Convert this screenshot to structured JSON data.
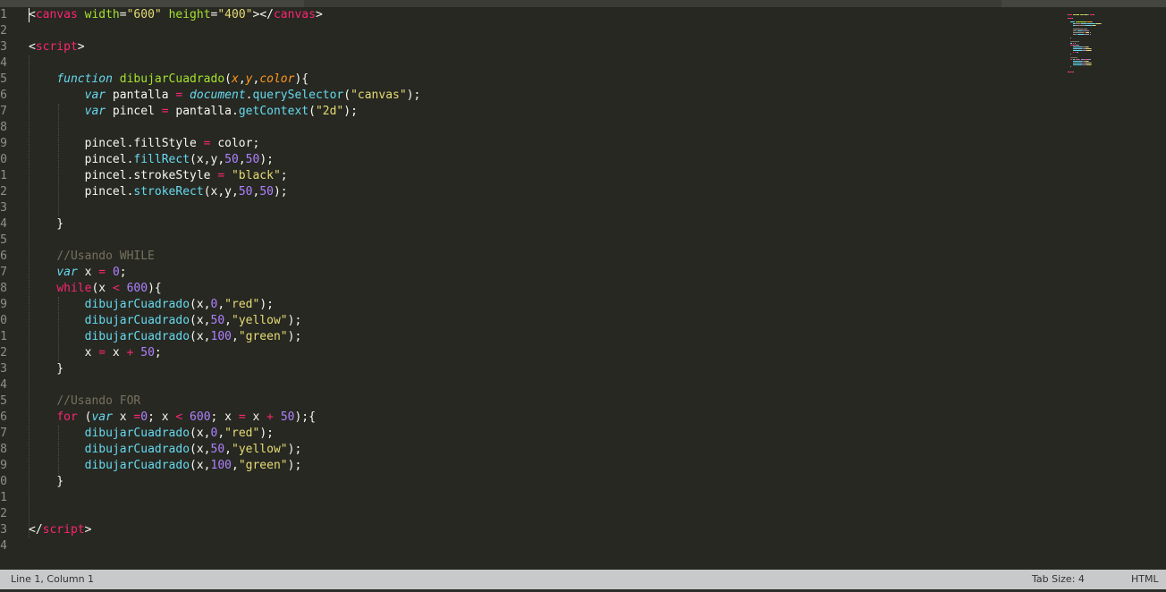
{
  "editor": {
    "line_numbers": [
      "1",
      "2",
      "3",
      "4",
      "5",
      "6",
      "7",
      "8",
      "9",
      "0",
      "1",
      "2",
      "3",
      "4",
      "5",
      "6",
      "7",
      "8",
      "9",
      "0",
      "1",
      "2",
      "3",
      "4",
      "5",
      "6",
      "7",
      "8",
      "9",
      "0",
      "1",
      "2",
      "3",
      "4"
    ],
    "lines": [
      [
        [
          "t-plain",
          "<"
        ],
        [
          "t-tag",
          "canvas"
        ],
        [
          "t-plain",
          " "
        ],
        [
          "t-attr",
          "width"
        ],
        [
          "t-plain",
          "="
        ],
        [
          "t-str",
          "\"600\""
        ],
        [
          "t-plain",
          " "
        ],
        [
          "t-attr",
          "height"
        ],
        [
          "t-plain",
          "="
        ],
        [
          "t-str",
          "\"400\""
        ],
        [
          "t-plain",
          "></"
        ],
        [
          "t-tag",
          "canvas"
        ],
        [
          "t-plain",
          ">"
        ]
      ],
      [],
      [
        [
          "t-plain",
          "<"
        ],
        [
          "t-tag",
          "script"
        ],
        [
          "t-plain",
          ">"
        ]
      ],
      [],
      [
        [
          "t-plain",
          "    "
        ],
        [
          "t-kw",
          "function"
        ],
        [
          "t-plain",
          " "
        ],
        [
          "t-fn",
          "dibujarCuadrado"
        ],
        [
          "t-plain",
          "("
        ],
        [
          "t-param",
          "x"
        ],
        [
          "t-plain",
          ","
        ],
        [
          "t-param",
          "y"
        ],
        [
          "t-plain",
          ","
        ],
        [
          "t-param",
          "color"
        ],
        [
          "t-plain",
          "){"
        ]
      ],
      [
        [
          "t-plain",
          "        "
        ],
        [
          "t-kw",
          "var"
        ],
        [
          "t-plain",
          " pantalla "
        ],
        [
          "t-op",
          "="
        ],
        [
          "t-plain",
          " "
        ],
        [
          "t-kw",
          "document"
        ],
        [
          "t-plain",
          "."
        ],
        [
          "t-prop",
          "querySelector"
        ],
        [
          "t-plain",
          "("
        ],
        [
          "t-str",
          "\"canvas\""
        ],
        [
          "t-plain",
          ");"
        ]
      ],
      [
        [
          "t-plain",
          "        "
        ],
        [
          "t-kw",
          "var"
        ],
        [
          "t-plain",
          " pincel "
        ],
        [
          "t-op",
          "="
        ],
        [
          "t-plain",
          " pantalla."
        ],
        [
          "t-prop",
          "getContext"
        ],
        [
          "t-plain",
          "("
        ],
        [
          "t-str",
          "\"2d\""
        ],
        [
          "t-plain",
          ");"
        ]
      ],
      [],
      [
        [
          "t-plain",
          "        pincel.fillStyle "
        ],
        [
          "t-op",
          "="
        ],
        [
          "t-plain",
          " color;"
        ]
      ],
      [
        [
          "t-plain",
          "        pincel."
        ],
        [
          "t-prop",
          "fillRect"
        ],
        [
          "t-plain",
          "(x,y,"
        ],
        [
          "t-num",
          "50"
        ],
        [
          "t-plain",
          ","
        ],
        [
          "t-num",
          "50"
        ],
        [
          "t-plain",
          ");"
        ]
      ],
      [
        [
          "t-plain",
          "        pincel.strokeStyle "
        ],
        [
          "t-op",
          "="
        ],
        [
          "t-plain",
          " "
        ],
        [
          "t-str",
          "\"black\""
        ],
        [
          "t-plain",
          ";"
        ]
      ],
      [
        [
          "t-plain",
          "        pincel."
        ],
        [
          "t-prop",
          "strokeRect"
        ],
        [
          "t-plain",
          "(x,y,"
        ],
        [
          "t-num",
          "50"
        ],
        [
          "t-plain",
          ","
        ],
        [
          "t-num",
          "50"
        ],
        [
          "t-plain",
          ");"
        ]
      ],
      [],
      [
        [
          "t-plain",
          "    }"
        ]
      ],
      [],
      [
        [
          "t-plain",
          "    "
        ],
        [
          "t-com",
          "//Usando WHILE"
        ]
      ],
      [
        [
          "t-plain",
          "    "
        ],
        [
          "t-kw",
          "var"
        ],
        [
          "t-plain",
          " x "
        ],
        [
          "t-op",
          "="
        ],
        [
          "t-plain",
          " "
        ],
        [
          "t-num",
          "0"
        ],
        [
          "t-plain",
          ";"
        ]
      ],
      [
        [
          "t-plain",
          "    "
        ],
        [
          "t-kwp",
          "while"
        ],
        [
          "t-plain",
          "(x "
        ],
        [
          "t-op",
          "<"
        ],
        [
          "t-plain",
          " "
        ],
        [
          "t-num",
          "600"
        ],
        [
          "t-plain",
          "){"
        ]
      ],
      [
        [
          "t-plain",
          "        "
        ],
        [
          "t-prop",
          "dibujarCuadrado"
        ],
        [
          "t-plain",
          "(x,"
        ],
        [
          "t-num",
          "0"
        ],
        [
          "t-plain",
          ","
        ],
        [
          "t-str",
          "\"red\""
        ],
        [
          "t-plain",
          ");"
        ]
      ],
      [
        [
          "t-plain",
          "        "
        ],
        [
          "t-prop",
          "dibujarCuadrado"
        ],
        [
          "t-plain",
          "(x,"
        ],
        [
          "t-num",
          "50"
        ],
        [
          "t-plain",
          ","
        ],
        [
          "t-str",
          "\"yellow\""
        ],
        [
          "t-plain",
          ");"
        ]
      ],
      [
        [
          "t-plain",
          "        "
        ],
        [
          "t-prop",
          "dibujarCuadrado"
        ],
        [
          "t-plain",
          "(x,"
        ],
        [
          "t-num",
          "100"
        ],
        [
          "t-plain",
          ","
        ],
        [
          "t-str",
          "\"green\""
        ],
        [
          "t-plain",
          ");"
        ]
      ],
      [
        [
          "t-plain",
          "        x "
        ],
        [
          "t-op",
          "="
        ],
        [
          "t-plain",
          " x "
        ],
        [
          "t-op",
          "+"
        ],
        [
          "t-plain",
          " "
        ],
        [
          "t-num",
          "50"
        ],
        [
          "t-plain",
          ";"
        ]
      ],
      [
        [
          "t-plain",
          "    }"
        ]
      ],
      [],
      [
        [
          "t-plain",
          "    "
        ],
        [
          "t-com",
          "//Usando FOR"
        ]
      ],
      [
        [
          "t-plain",
          "    "
        ],
        [
          "t-kwp",
          "for"
        ],
        [
          "t-plain",
          " ("
        ],
        [
          "t-kw",
          "var"
        ],
        [
          "t-plain",
          " x "
        ],
        [
          "t-op",
          "="
        ],
        [
          "t-num",
          "0"
        ],
        [
          "t-plain",
          "; x "
        ],
        [
          "t-op",
          "<"
        ],
        [
          "t-plain",
          " "
        ],
        [
          "t-num",
          "600"
        ],
        [
          "t-plain",
          "; x "
        ],
        [
          "t-op",
          "="
        ],
        [
          "t-plain",
          " x "
        ],
        [
          "t-op",
          "+"
        ],
        [
          "t-plain",
          " "
        ],
        [
          "t-num",
          "50"
        ],
        [
          "t-plain",
          ");{"
        ]
      ],
      [
        [
          "t-plain",
          "        "
        ],
        [
          "t-prop",
          "dibujarCuadrado"
        ],
        [
          "t-plain",
          "(x,"
        ],
        [
          "t-num",
          "0"
        ],
        [
          "t-plain",
          ","
        ],
        [
          "t-str",
          "\"red\""
        ],
        [
          "t-plain",
          ");"
        ]
      ],
      [
        [
          "t-plain",
          "        "
        ],
        [
          "t-prop",
          "dibujarCuadrado"
        ],
        [
          "t-plain",
          "(x,"
        ],
        [
          "t-num",
          "50"
        ],
        [
          "t-plain",
          ","
        ],
        [
          "t-str",
          "\"yellow\""
        ],
        [
          "t-plain",
          ");"
        ]
      ],
      [
        [
          "t-plain",
          "        "
        ],
        [
          "t-prop",
          "dibujarCuadrado"
        ],
        [
          "t-plain",
          "(x,"
        ],
        [
          "t-num",
          "100"
        ],
        [
          "t-plain",
          ","
        ],
        [
          "t-str",
          "\"green\""
        ],
        [
          "t-plain",
          ");"
        ]
      ],
      [
        [
          "t-plain",
          "    }"
        ]
      ],
      [],
      [],
      [
        [
          "t-plain",
          "</"
        ],
        [
          "t-tag",
          "script"
        ],
        [
          "t-plain",
          ">"
        ]
      ],
      []
    ]
  },
  "statusbar": {
    "position": "Line 1, Column 1",
    "tab_size": "Tab Size: 4",
    "syntax": "HTML"
  },
  "theme": {
    "background": "#272822",
    "foreground": "#f8f8f2",
    "tag": "#f92672",
    "string": "#e6db74",
    "keyword": "#66d9ef",
    "function": "#a6e22e",
    "number": "#ae81ff",
    "comment": "#75715e",
    "statusbar": "#c8c9cb"
  }
}
